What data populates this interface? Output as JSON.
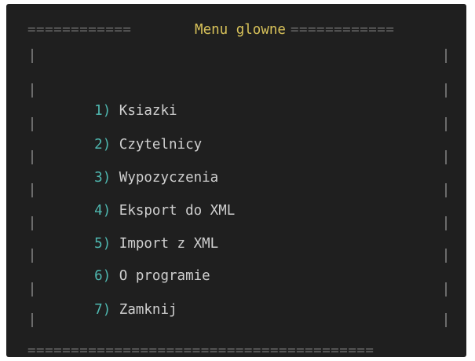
{
  "menu": {
    "title": "Menu glowne",
    "top_rule_left": "============",
    "top_rule_right": "============",
    "bottom_rule": "========================================",
    "items": [
      {
        "num": "1)",
        "label": "Ksiazki"
      },
      {
        "num": "2)",
        "label": "Czytelnicy"
      },
      {
        "num": "3)",
        "label": "Wypozyczenia"
      },
      {
        "num": "4)",
        "label": "Eksport do XML"
      },
      {
        "num": "5)",
        "label": "Import z XML"
      },
      {
        "num": "6)",
        "label": "O programie"
      },
      {
        "num": "7)",
        "label": "Zamknij"
      }
    ]
  },
  "colors": {
    "background": "#1f1f1f",
    "title": "#d8c25a",
    "number": "#4fb8b0",
    "label": "#cfcfcf",
    "border": "#6b6b6b"
  }
}
